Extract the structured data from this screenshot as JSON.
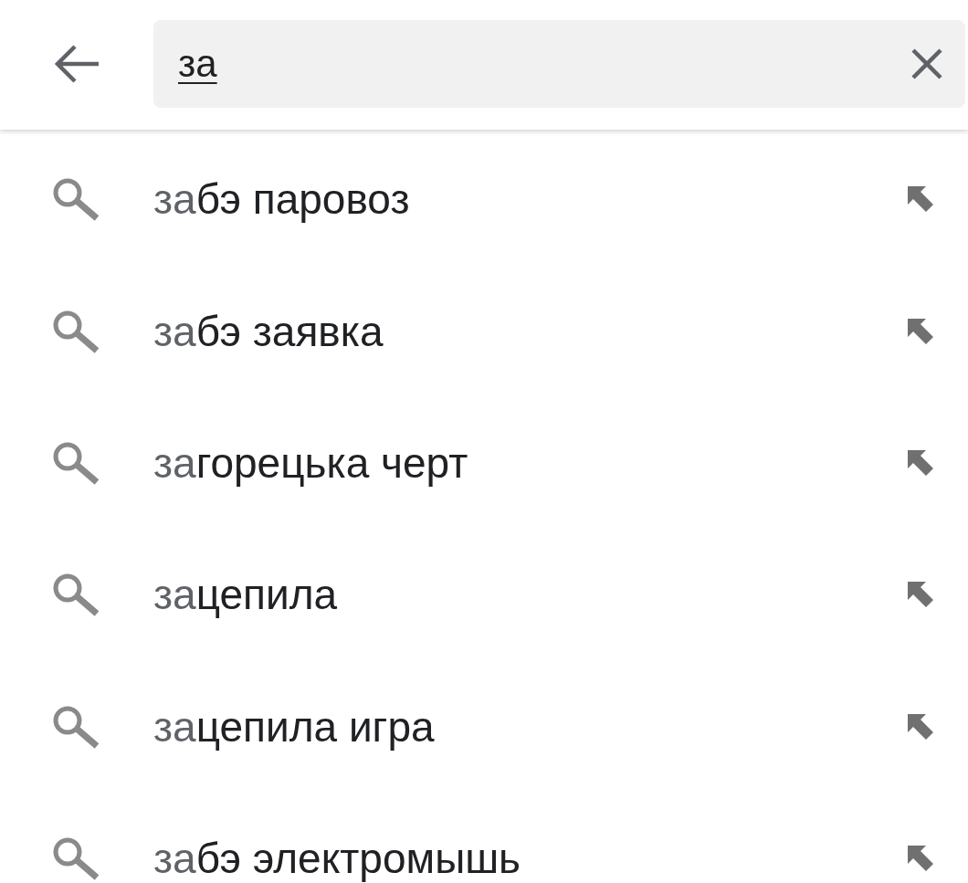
{
  "search": {
    "value": "за"
  },
  "suggestions": [
    {
      "match": "за",
      "completion": "бэ паровоз"
    },
    {
      "match": "за",
      "completion": "бэ заявка"
    },
    {
      "match": "за",
      "completion": "горецька черт"
    },
    {
      "match": "за",
      "completion": "цепила"
    },
    {
      "match": "за",
      "completion": "цепила игра"
    },
    {
      "match": "за",
      "completion": "бэ электромышь"
    }
  ]
}
